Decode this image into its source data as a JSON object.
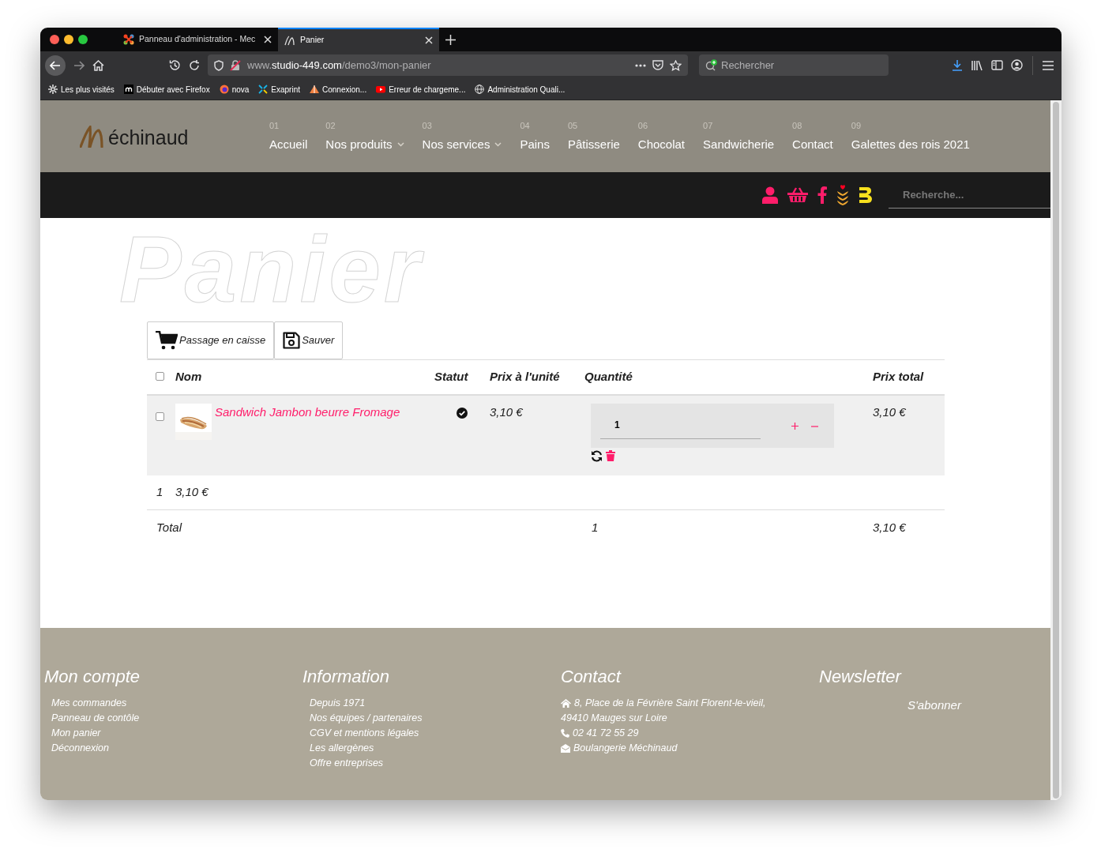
{
  "browser": {
    "tabs": [
      {
        "title": "Panneau d'administration - Mec",
        "selected": false
      },
      {
        "title": "Panier",
        "selected": true
      }
    ],
    "url": "www.**studio-449.com**/demo3/mon-panier",
    "search": {
      "placeholder": "Rechercher"
    },
    "bookmarks": [
      "Les plus visités",
      "Débuter avec Firefox",
      "nova",
      "Exaprint",
      "Connexion...",
      "Erreur de chargeme...",
      "Administration Quali..."
    ]
  },
  "site": {
    "logo": "échinaud",
    "nav": [
      {
        "number": "01",
        "label": "Accueil",
        "dropdown": false
      },
      {
        "number": "02",
        "label": "Nos produits",
        "dropdown": true
      },
      {
        "number": "03",
        "label": "Nos services",
        "dropdown": true
      },
      {
        "number": "04",
        "label": "Pains",
        "dropdown": false
      },
      {
        "number": "05",
        "label": "Pâtisserie",
        "dropdown": false
      },
      {
        "number": "06",
        "label": "Chocolat",
        "dropdown": false
      },
      {
        "number": "07",
        "label": "Sandwicherie",
        "dropdown": false
      },
      {
        "number": "08",
        "label": "Contact",
        "dropdown": false
      },
      {
        "number": "09",
        "label": "Galettes des rois 2021",
        "dropdown": false
      }
    ],
    "search": {
      "placeholder": "Recherche..."
    }
  },
  "page_title": "Panier",
  "actions": [
    {
      "kind": "cart",
      "label": "Passage en caisse"
    },
    {
      "kind": "save",
      "label": "Sauver"
    }
  ],
  "table": {
    "select_all": false,
    "columns": [
      "Nom",
      "Statut",
      "Prix à l'unité",
      "Quantité",
      "Prix total"
    ],
    "rows": [
      {
        "checked": false,
        "name": "Sandwich Jambon beurre Fromage",
        "available": true,
        "unit_price": "3,10 €",
        "quantity": "1",
        "total": "3,10 €"
      }
    ],
    "summary": {
      "count": "1",
      "amount": "3,10 €"
    },
    "total": {
      "label": "Total",
      "quantity": "1",
      "amount": "3,10 €"
    }
  },
  "footer": [
    {
      "title": "Mon compte",
      "links": [
        "Mes commandes",
        "Panneau de contôle",
        "Mon panier",
        "Déconnexion"
      ]
    },
    {
      "title": "Information",
      "links": [
        "Depuis 1971",
        "Nos équipes / partenaires",
        "CGV et mentions légales",
        "Les allergènes",
        "Offre entreprises"
      ]
    },
    {
      "title": "Contact",
      "items": [
        {
          "kind": "address",
          "lines": [
            "8, Place de la Févrière Saint Florent-le-vieil,",
            "49410 Mauges sur Loire"
          ]
        },
        {
          "kind": "phone",
          "lines": [
            "02 41 72 55 29"
          ]
        },
        {
          "kind": "mail",
          "lines": [
            "Boulangerie Méchinaud"
          ]
        }
      ]
    },
    {
      "title": "Newsletter",
      "button": "S'abonner"
    }
  ]
}
